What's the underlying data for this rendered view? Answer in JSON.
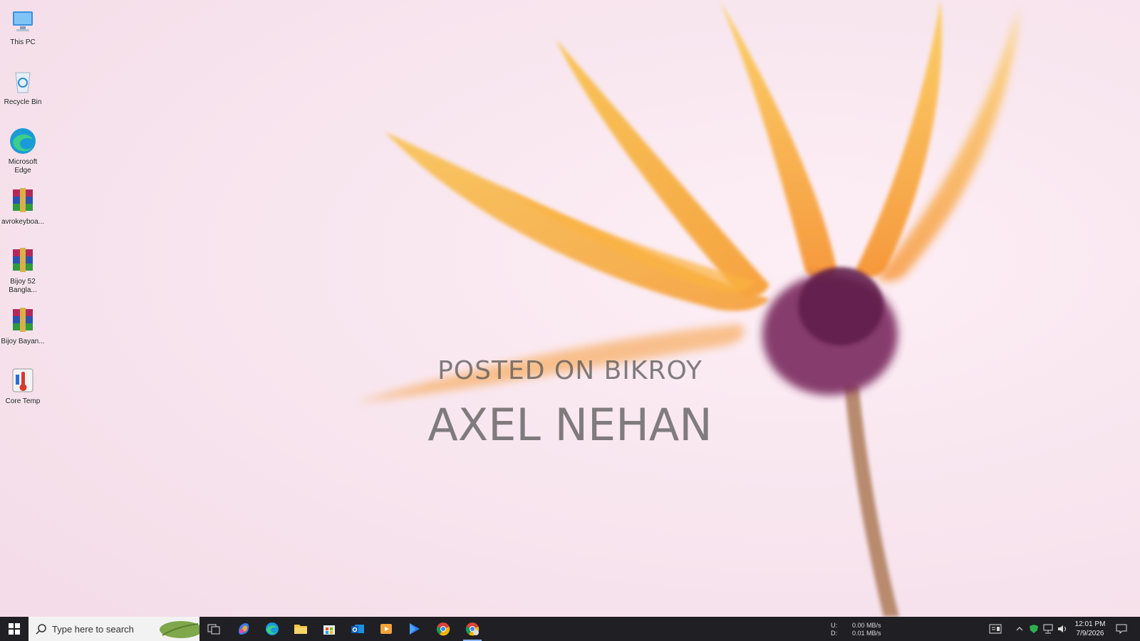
{
  "desktop": {
    "icons": [
      {
        "label": "This PC",
        "icon": "this-pc-icon"
      },
      {
        "label": "Recycle Bin",
        "icon": "recycle-bin-icon"
      },
      {
        "label": "Microsoft Edge",
        "icon": "edge-icon"
      },
      {
        "label": "avrokeyboa...",
        "icon": "winrar-archive-icon"
      },
      {
        "label": "Bijoy 52 Bangla...",
        "icon": "winrar-archive-icon"
      },
      {
        "label": "Bijoy Bayan...",
        "icon": "winrar-archive-icon"
      },
      {
        "label": "Core Temp",
        "icon": "core-temp-icon"
      }
    ]
  },
  "watermark": {
    "line1": "POSTED ON BIKROY",
    "line2": "AXEL NEHAN"
  },
  "taskbar": {
    "search_placeholder": "Type here to search",
    "apps": [
      {
        "name": "task-view-icon"
      },
      {
        "name": "copilot-icon"
      },
      {
        "name": "edge-icon"
      },
      {
        "name": "file-explorer-icon"
      },
      {
        "name": "microsoft-store-icon"
      },
      {
        "name": "outlook-icon"
      },
      {
        "name": "media-player-icon"
      },
      {
        "name": "play-store-icon"
      },
      {
        "name": "chrome-icon"
      },
      {
        "name": "chrome-profile-icon",
        "active": true
      }
    ],
    "network": {
      "upload_label": "U:",
      "upload_value": "0.00 MB/s",
      "download_label": "D:",
      "download_value": "0.01 MB/s"
    },
    "clock": {
      "time": "12:01 PM",
      "date": "7/9/2026"
    },
    "accent": "#8ab4f8"
  }
}
